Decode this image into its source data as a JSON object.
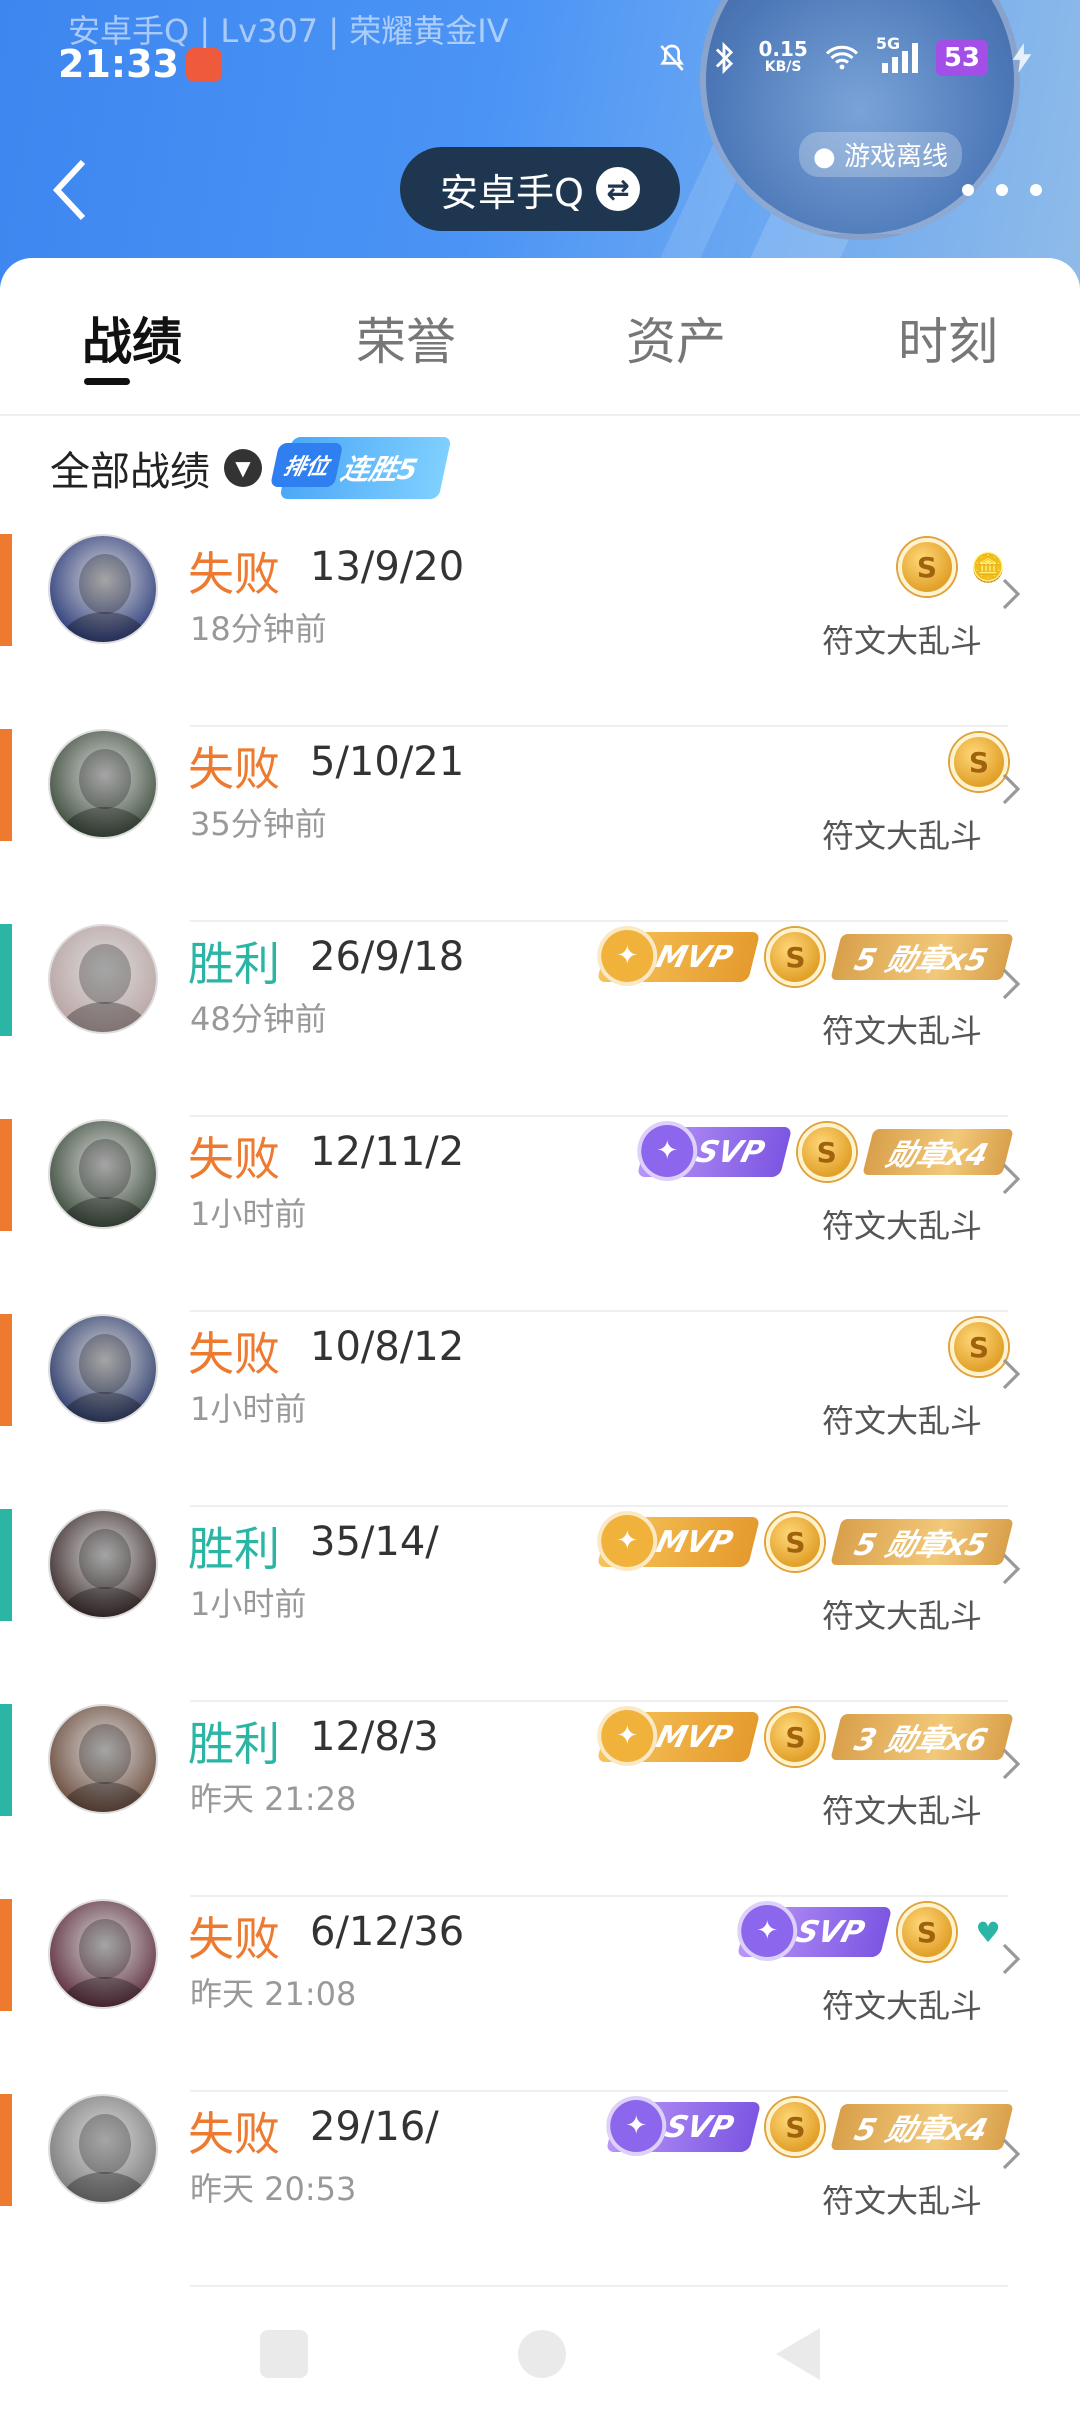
{
  "status_bar": {
    "subtitle": "安卓手Q | Lv307 | 荣耀黄金IV",
    "time": "21:33",
    "net_speed_value": "0.15",
    "net_speed_unit": "KB/S",
    "signal": "5G",
    "battery": "53"
  },
  "header": {
    "title": "安卓手Q",
    "swap_glyph": "⇄",
    "status": "游戏离线"
  },
  "tabs": [
    {
      "label": "战绩"
    },
    {
      "label": "荣誉"
    },
    {
      "label": "资产"
    },
    {
      "label": "时刻"
    }
  ],
  "filter": {
    "label": "全部战绩",
    "streak_ranked": "排位",
    "streak_text": "连胜5"
  },
  "matches": [
    {
      "result": "失败",
      "kda": "13/9/20",
      "time": "18分钟前",
      "mode": "符文大乱斗",
      "outcome": "lose",
      "avatar_color": "#2a3a7a"
    },
    {
      "result": "失败",
      "kda": "5/10/21",
      "time": "35分钟前",
      "mode": "符文大乱斗",
      "outcome": "lose",
      "avatar_color": "#3a4a3a"
    },
    {
      "result": "胜利",
      "kda": "26/9/18",
      "time": "48分钟前",
      "mode": "符文大乱斗",
      "outcome": "win",
      "avatar_color": "#b9a3a3",
      "mvp": "MVP",
      "medal": "5 勋章x5"
    },
    {
      "result": "失败",
      "kda": "12/11/2",
      "time": "1小时前",
      "mode": "符文大乱斗",
      "outcome": "lose",
      "avatar_color": "#3a4a3a",
      "svp": "SVP",
      "medal": "勋章x4"
    },
    {
      "result": "失败",
      "kda": "10/8/12",
      "time": "1小时前",
      "mode": "符文大乱斗",
      "outcome": "lose",
      "avatar_color": "#2b3a6a"
    },
    {
      "result": "胜利",
      "kda": "35/14/",
      "time": "1小时前",
      "mode": "符文大乱斗",
      "outcome": "win",
      "avatar_color": "#3a2a2a",
      "mvp": "MVP",
      "medal": "5 勋章x5"
    },
    {
      "result": "胜利",
      "kda": "12/8/3",
      "time": "昨天 21:28",
      "mode": "符文大乱斗",
      "outcome": "win",
      "avatar_color": "#6a4a3a",
      "mvp": "MVP",
      "medal": "3 勋章x6"
    },
    {
      "result": "失败",
      "kda": "6/12/36",
      "time": "昨天 21:08",
      "mode": "符文大乱斗",
      "outcome": "lose",
      "avatar_color": "#5a2a3a",
      "svp": "SVP"
    },
    {
      "result": "失败",
      "kda": "29/16/",
      "time": "昨天 20:53",
      "mode": "符文大乱斗",
      "outcome": "lose",
      "avatar_color": "#7a7a7a",
      "svp": "SVP",
      "medal": "5 勋章x4"
    }
  ],
  "colors": {
    "lose": "#ee7a2f",
    "win": "#2bb5a4",
    "header_gradient_start": "#3d86f0"
  }
}
